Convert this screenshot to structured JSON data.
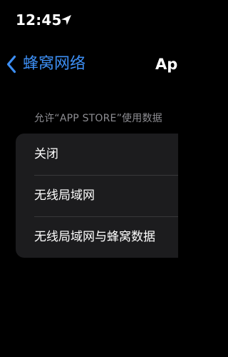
{
  "status_bar": {
    "time": "12:45",
    "location_icon": "location-arrow-icon"
  },
  "nav": {
    "back_label": "蜂窝网络",
    "back_icon": "chevron-left-icon",
    "title": "App",
    "accent_color": "#3d8ff5"
  },
  "section": {
    "header": "允许“APP STORE”使用数据"
  },
  "options": [
    {
      "label": "关闭"
    },
    {
      "label": "无线局域网"
    },
    {
      "label": "无线局域网与蜂窝数据"
    }
  ]
}
